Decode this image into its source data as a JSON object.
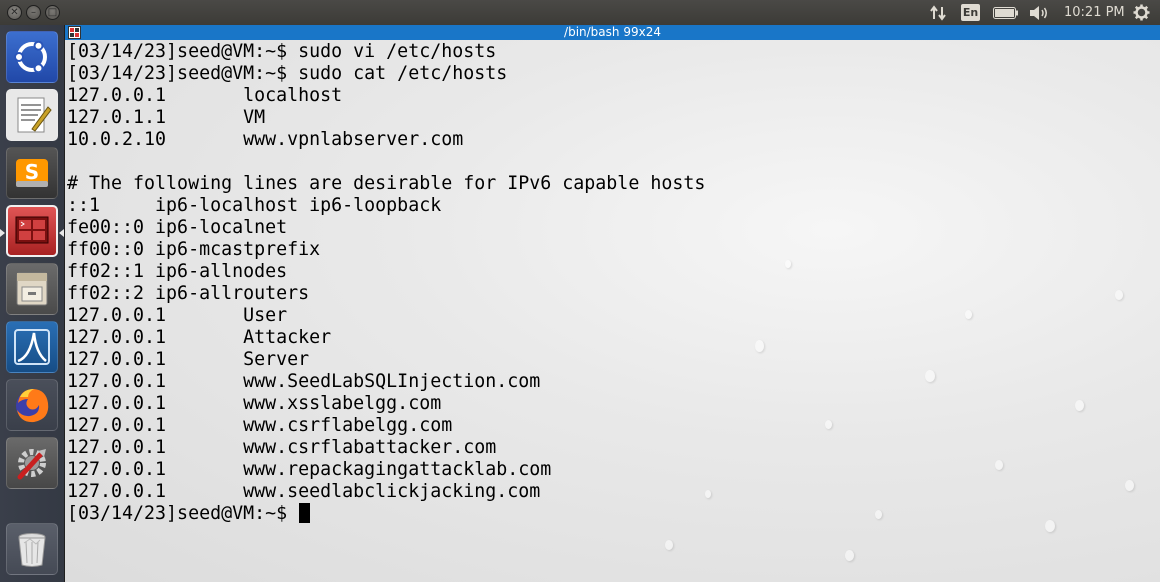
{
  "top_panel": {
    "clock": "10:21 PM",
    "keyboard_layout": "En",
    "icons": [
      "close-icon",
      "minimize-icon",
      "maximize-icon",
      "network-transfer-icon",
      "keyboard-layout-icon",
      "battery-icon",
      "volume-icon",
      "power-gear-icon"
    ]
  },
  "launcher": {
    "items": [
      {
        "name": "ubuntu-dash",
        "icon": "ubuntu-logo-icon"
      },
      {
        "name": "text-editor",
        "icon": "text-editor-icon"
      },
      {
        "name": "sublime-text",
        "icon": "sublime-text-icon",
        "glyph": "S"
      },
      {
        "name": "terminal",
        "icon": "terminal-icon",
        "active": true
      },
      {
        "name": "files",
        "icon": "file-cabinet-icon"
      },
      {
        "name": "wireshark",
        "icon": "wireshark-fin-icon"
      },
      {
        "name": "firefox",
        "icon": "firefox-icon"
      },
      {
        "name": "system-settings",
        "icon": "settings-wrench-icon"
      },
      {
        "name": "trash",
        "icon": "trash-icon"
      }
    ]
  },
  "terminal": {
    "title": "/bin/bash 99x24",
    "lines": [
      "[03/14/23]seed@VM:~$ sudo vi /etc/hosts",
      "[03/14/23]seed@VM:~$ sudo cat /etc/hosts",
      "127.0.0.1       localhost",
      "127.0.1.1       VM",
      "10.0.2.10       www.vpnlabserver.com",
      "",
      "# The following lines are desirable for IPv6 capable hosts",
      "::1     ip6-localhost ip6-loopback",
      "fe00::0 ip6-localnet",
      "ff00::0 ip6-mcastprefix",
      "ff02::1 ip6-allnodes",
      "ff02::2 ip6-allrouters",
      "127.0.0.1       User",
      "127.0.0.1       Attacker",
      "127.0.0.1       Server",
      "127.0.0.1       www.SeedLabSQLInjection.com",
      "127.0.0.1       www.xsslabelgg.com",
      "127.0.0.1       www.csrflabelgg.com",
      "127.0.0.1       www.csrflabattacker.com",
      "127.0.0.1       www.repackagingattacklab.com",
      "127.0.0.1       www.seedlabclickjacking.com"
    ],
    "prompt": "[03/14/23]seed@VM:~$ ",
    "colors": {
      "titlebar": "#1976c8",
      "text": "#000000"
    }
  }
}
